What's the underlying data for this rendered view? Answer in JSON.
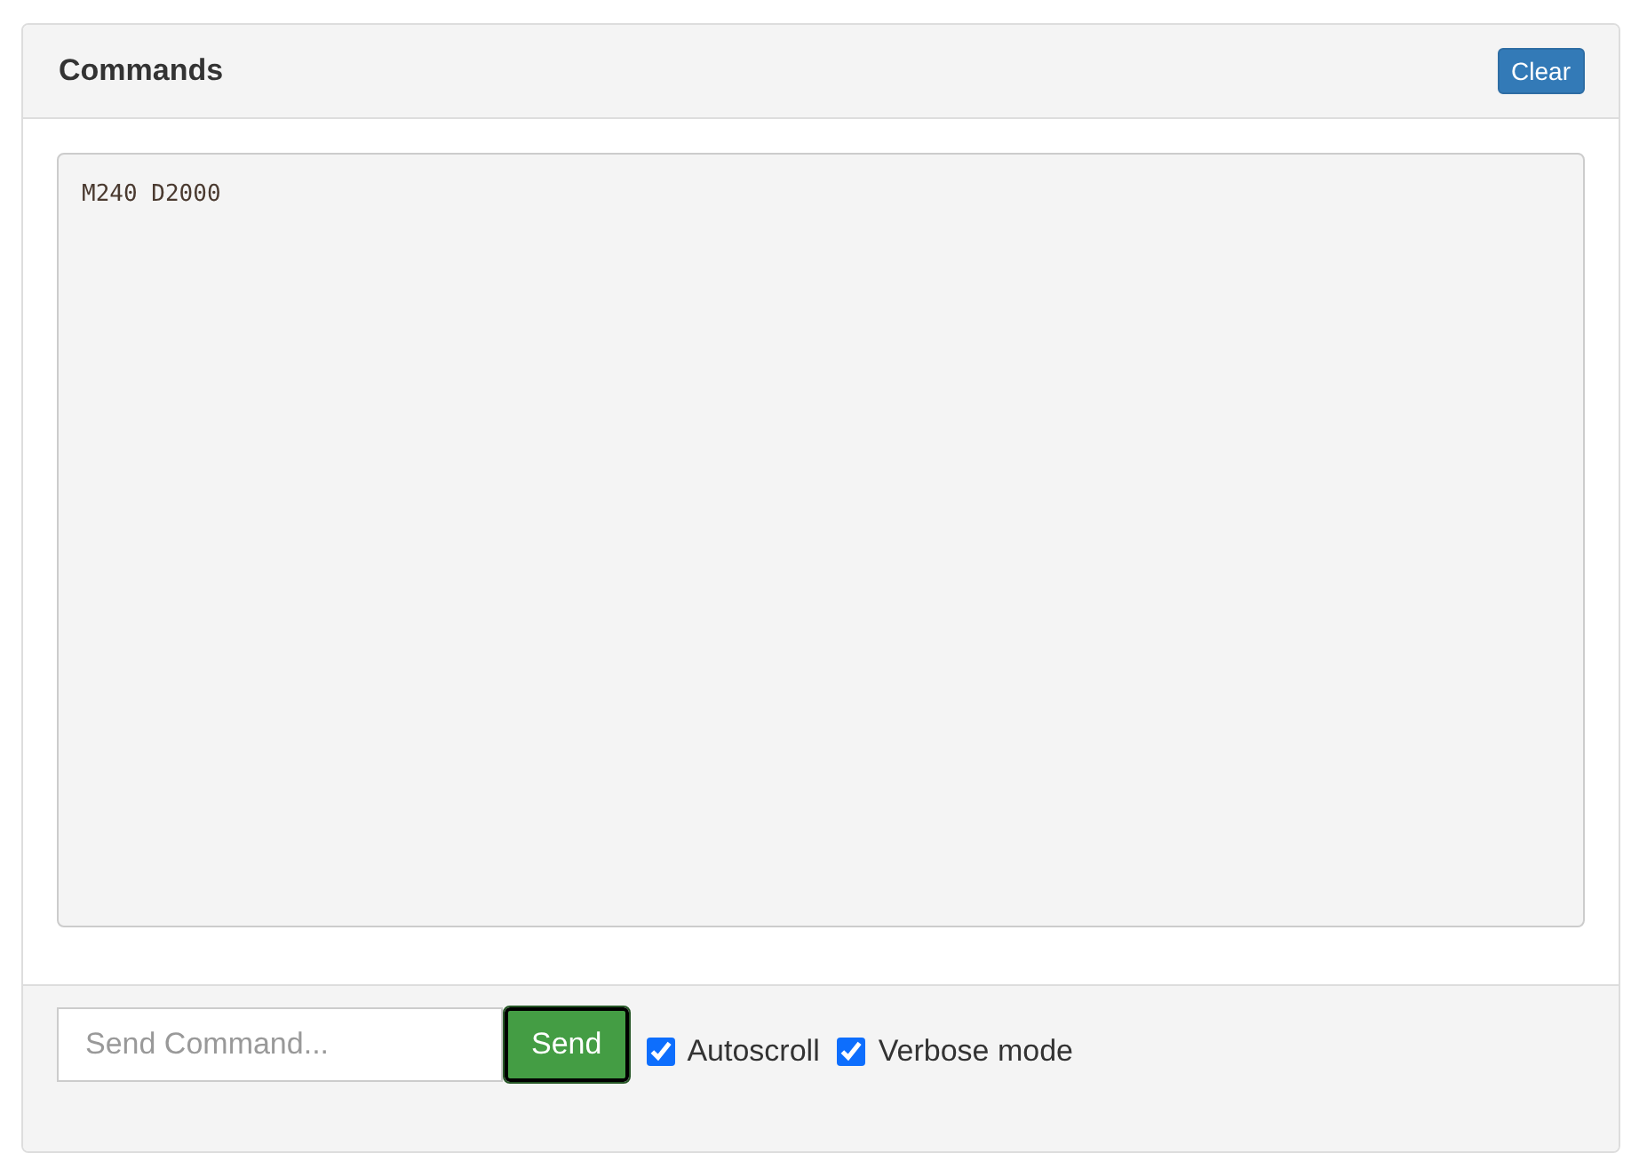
{
  "panel": {
    "title": "Commands",
    "clear_button": "Clear"
  },
  "log": {
    "lines": [
      "M240 D2000"
    ]
  },
  "footer": {
    "input": {
      "placeholder": "Send Command..."
    },
    "send_button": "Send",
    "options": [
      {
        "label": "Autoscroll",
        "checked": true
      },
      {
        "label": "Verbose mode",
        "checked": true
      }
    ]
  }
}
